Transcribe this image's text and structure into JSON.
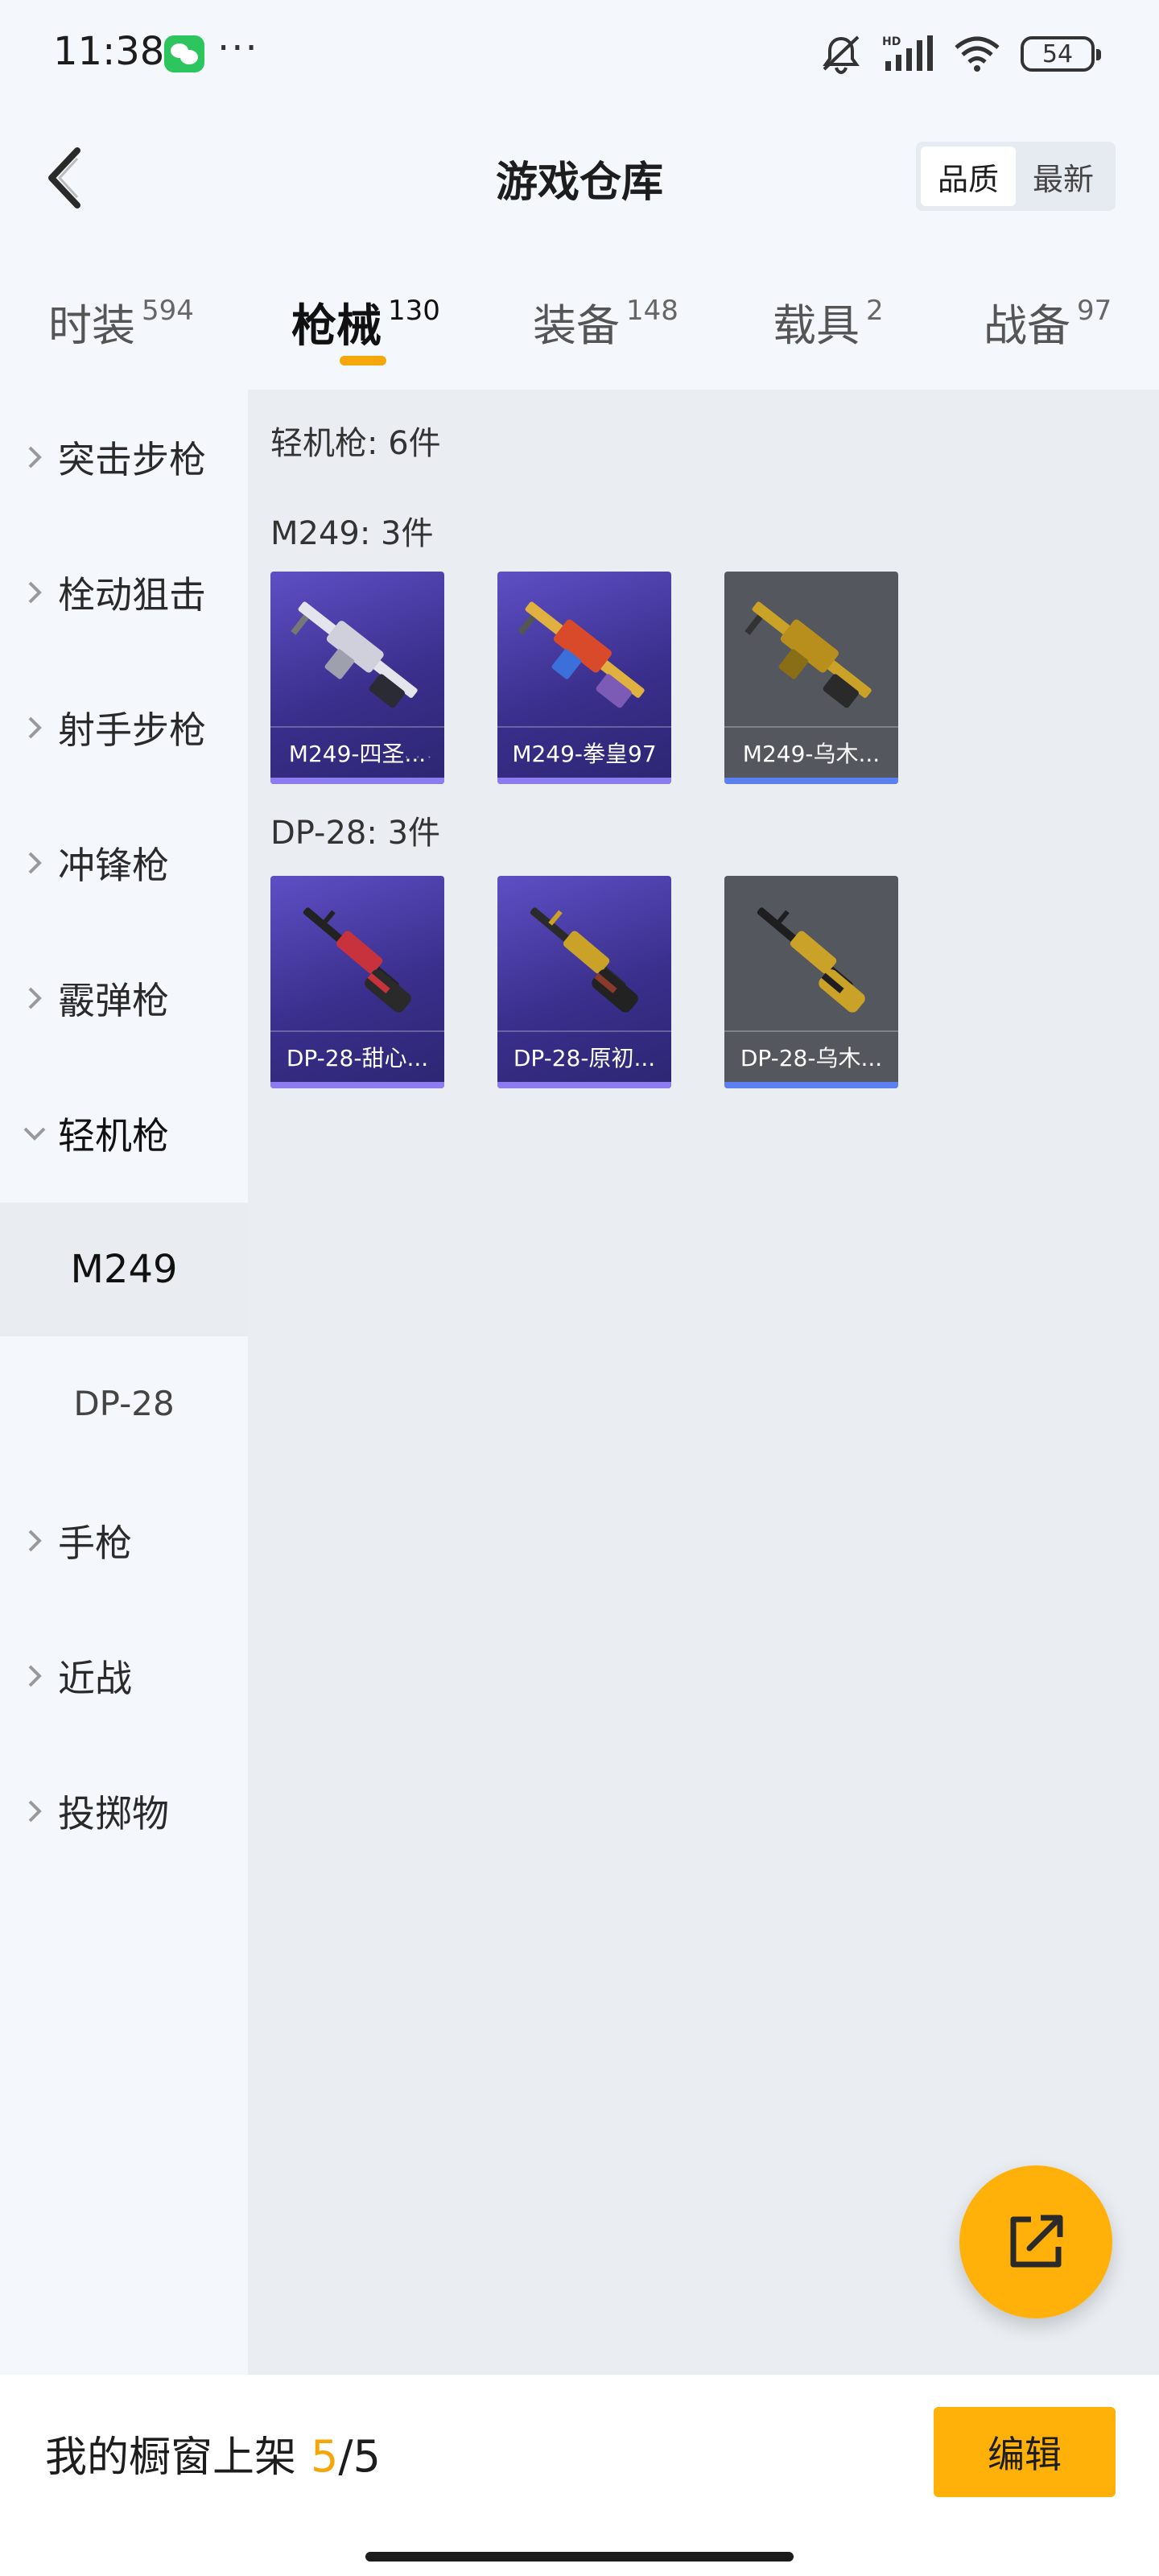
{
  "status_bar": {
    "time": "11:38",
    "icons": [
      "wechat-icon",
      "more-dots-icon",
      "mute-icon",
      "hd-signal-icon",
      "wifi-icon",
      "battery-icon"
    ],
    "battery": "54"
  },
  "header": {
    "title": "游戏仓库",
    "sort_options": [
      "品质",
      "最新"
    ],
    "active_sort": "品质"
  },
  "tabs": [
    {
      "label": "时装",
      "count": "594"
    },
    {
      "label": "枪械",
      "count": "130",
      "active": true
    },
    {
      "label": "装备",
      "count": "148"
    },
    {
      "label": "载具",
      "count": "2"
    },
    {
      "label": "战备",
      "count": "97"
    }
  ],
  "sidebar": {
    "items": [
      {
        "label": "突击步枪"
      },
      {
        "label": "栓动狙击"
      },
      {
        "label": "射手步枪"
      },
      {
        "label": "冲锋枪"
      },
      {
        "label": "霰弹枪"
      },
      {
        "label": "轻机枪",
        "expanded": true
      },
      {
        "label": "手枪"
      },
      {
        "label": "近战"
      },
      {
        "label": "投掷物"
      }
    ],
    "sub_items": [
      {
        "label": "M249",
        "active": true
      },
      {
        "label": "DP-28"
      }
    ]
  },
  "main": {
    "category_title": "轻机枪: 6件",
    "groups": [
      {
        "title": "M249: 3件",
        "items": [
          {
            "name": "M249-四圣...",
            "rarity": "purple",
            "accent": "#d8d8e0"
          },
          {
            "name": "M249-拳皇97",
            "rarity": "purple",
            "accent": "#d94a2b"
          },
          {
            "name": "M249-乌木...",
            "rarity": "gray",
            "accent": "#c9a227"
          }
        ]
      },
      {
        "title": "DP-28: 3件",
        "items": [
          {
            "name": "DP-28-甜心...",
            "rarity": "purple",
            "accent": "#c8323c"
          },
          {
            "name": "DP-28-原初...",
            "rarity": "purple",
            "accent": "#c9a227"
          },
          {
            "name": "DP-28-乌木...",
            "rarity": "gray",
            "accent": "#c9a227"
          }
        ]
      }
    ]
  },
  "bottom": {
    "label": "我的橱窗上架",
    "listed": "5",
    "separator": "/",
    "capacity": "5",
    "edit_label": "编辑"
  },
  "colors": {
    "accent": "#ffb109",
    "tab_indicator": "#f5a70a",
    "purple_card": "#4a3da8",
    "gray_card": "#54575e"
  }
}
